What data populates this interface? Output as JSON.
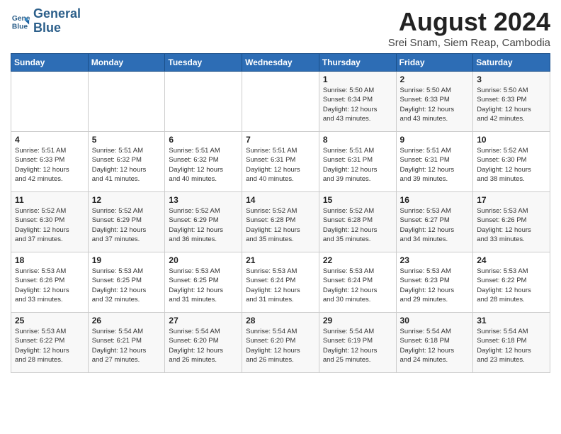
{
  "header": {
    "logo_line1": "General",
    "logo_line2": "Blue",
    "month_year": "August 2024",
    "location": "Srei Snam, Siem Reap, Cambodia"
  },
  "days_of_week": [
    "Sunday",
    "Monday",
    "Tuesday",
    "Wednesday",
    "Thursday",
    "Friday",
    "Saturday"
  ],
  "weeks": [
    [
      {
        "day": "",
        "info": ""
      },
      {
        "day": "",
        "info": ""
      },
      {
        "day": "",
        "info": ""
      },
      {
        "day": "",
        "info": ""
      },
      {
        "day": "1",
        "info": "Sunrise: 5:50 AM\nSunset: 6:34 PM\nDaylight: 12 hours\nand 43 minutes."
      },
      {
        "day": "2",
        "info": "Sunrise: 5:50 AM\nSunset: 6:33 PM\nDaylight: 12 hours\nand 43 minutes."
      },
      {
        "day": "3",
        "info": "Sunrise: 5:50 AM\nSunset: 6:33 PM\nDaylight: 12 hours\nand 42 minutes."
      }
    ],
    [
      {
        "day": "4",
        "info": "Sunrise: 5:51 AM\nSunset: 6:33 PM\nDaylight: 12 hours\nand 42 minutes."
      },
      {
        "day": "5",
        "info": "Sunrise: 5:51 AM\nSunset: 6:32 PM\nDaylight: 12 hours\nand 41 minutes."
      },
      {
        "day": "6",
        "info": "Sunrise: 5:51 AM\nSunset: 6:32 PM\nDaylight: 12 hours\nand 40 minutes."
      },
      {
        "day": "7",
        "info": "Sunrise: 5:51 AM\nSunset: 6:31 PM\nDaylight: 12 hours\nand 40 minutes."
      },
      {
        "day": "8",
        "info": "Sunrise: 5:51 AM\nSunset: 6:31 PM\nDaylight: 12 hours\nand 39 minutes."
      },
      {
        "day": "9",
        "info": "Sunrise: 5:51 AM\nSunset: 6:31 PM\nDaylight: 12 hours\nand 39 minutes."
      },
      {
        "day": "10",
        "info": "Sunrise: 5:52 AM\nSunset: 6:30 PM\nDaylight: 12 hours\nand 38 minutes."
      }
    ],
    [
      {
        "day": "11",
        "info": "Sunrise: 5:52 AM\nSunset: 6:30 PM\nDaylight: 12 hours\nand 37 minutes."
      },
      {
        "day": "12",
        "info": "Sunrise: 5:52 AM\nSunset: 6:29 PM\nDaylight: 12 hours\nand 37 minutes."
      },
      {
        "day": "13",
        "info": "Sunrise: 5:52 AM\nSunset: 6:29 PM\nDaylight: 12 hours\nand 36 minutes."
      },
      {
        "day": "14",
        "info": "Sunrise: 5:52 AM\nSunset: 6:28 PM\nDaylight: 12 hours\nand 35 minutes."
      },
      {
        "day": "15",
        "info": "Sunrise: 5:52 AM\nSunset: 6:28 PM\nDaylight: 12 hours\nand 35 minutes."
      },
      {
        "day": "16",
        "info": "Sunrise: 5:53 AM\nSunset: 6:27 PM\nDaylight: 12 hours\nand 34 minutes."
      },
      {
        "day": "17",
        "info": "Sunrise: 5:53 AM\nSunset: 6:26 PM\nDaylight: 12 hours\nand 33 minutes."
      }
    ],
    [
      {
        "day": "18",
        "info": "Sunrise: 5:53 AM\nSunset: 6:26 PM\nDaylight: 12 hours\nand 33 minutes."
      },
      {
        "day": "19",
        "info": "Sunrise: 5:53 AM\nSunset: 6:25 PM\nDaylight: 12 hours\nand 32 minutes."
      },
      {
        "day": "20",
        "info": "Sunrise: 5:53 AM\nSunset: 6:25 PM\nDaylight: 12 hours\nand 31 minutes."
      },
      {
        "day": "21",
        "info": "Sunrise: 5:53 AM\nSunset: 6:24 PM\nDaylight: 12 hours\nand 31 minutes."
      },
      {
        "day": "22",
        "info": "Sunrise: 5:53 AM\nSunset: 6:24 PM\nDaylight: 12 hours\nand 30 minutes."
      },
      {
        "day": "23",
        "info": "Sunrise: 5:53 AM\nSunset: 6:23 PM\nDaylight: 12 hours\nand 29 minutes."
      },
      {
        "day": "24",
        "info": "Sunrise: 5:53 AM\nSunset: 6:22 PM\nDaylight: 12 hours\nand 28 minutes."
      }
    ],
    [
      {
        "day": "25",
        "info": "Sunrise: 5:53 AM\nSunset: 6:22 PM\nDaylight: 12 hours\nand 28 minutes."
      },
      {
        "day": "26",
        "info": "Sunrise: 5:54 AM\nSunset: 6:21 PM\nDaylight: 12 hours\nand 27 minutes."
      },
      {
        "day": "27",
        "info": "Sunrise: 5:54 AM\nSunset: 6:20 PM\nDaylight: 12 hours\nand 26 minutes."
      },
      {
        "day": "28",
        "info": "Sunrise: 5:54 AM\nSunset: 6:20 PM\nDaylight: 12 hours\nand 26 minutes."
      },
      {
        "day": "29",
        "info": "Sunrise: 5:54 AM\nSunset: 6:19 PM\nDaylight: 12 hours\nand 25 minutes."
      },
      {
        "day": "30",
        "info": "Sunrise: 5:54 AM\nSunset: 6:18 PM\nDaylight: 12 hours\nand 24 minutes."
      },
      {
        "day": "31",
        "info": "Sunrise: 5:54 AM\nSunset: 6:18 PM\nDaylight: 12 hours\nand 23 minutes."
      }
    ]
  ]
}
